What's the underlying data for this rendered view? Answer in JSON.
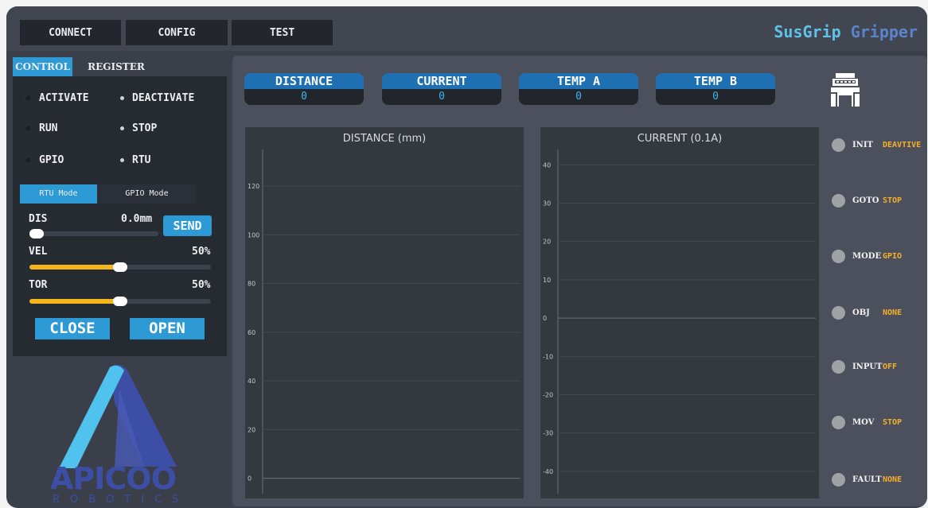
{
  "toolbar": {
    "connect": "CONNECT",
    "config": "CONFIG",
    "test": "TEST"
  },
  "brand": {
    "part1": "SusGrip",
    "part2": "Gripper"
  },
  "tabs": {
    "control": "CONTROL",
    "register": "REGISTER"
  },
  "control": {
    "activate": "ACTIVATE",
    "deactivate": "DEACTIVATE",
    "run": "RUN",
    "stop": "STOP",
    "gpio": "GPIO",
    "rtu": "RTU",
    "rtu_mode": "RTU Mode",
    "gpio_mode": "GPIO Mode",
    "dis_label": "DIS",
    "dis_value": "0.0mm",
    "send": "SEND",
    "vel_label": "VEL",
    "vel_value": "50%",
    "tor_label": "TOR",
    "tor_value": "50%",
    "close": "CLOSE",
    "open": "OPEN",
    "dis_level": 0,
    "vel_level": 0.5,
    "tor_level": 0.5
  },
  "logo": {
    "name": "APICOO",
    "sub": "ROBOTICS"
  },
  "meters": [
    {
      "label": "DISTANCE",
      "value": "0"
    },
    {
      "label": "CURRENT",
      "value": "0"
    },
    {
      "label": "TEMP A",
      "value": "0"
    },
    {
      "label": "TEMP B",
      "value": "0"
    }
  ],
  "charts": {
    "distance": {
      "title": "DISTANCE (mm)",
      "ticks": [
        "120",
        "100",
        "80",
        "60",
        "40",
        "20",
        "0"
      ]
    },
    "current": {
      "title": "CURRENT (0.1A)",
      "ticks": [
        "40",
        "30",
        "20",
        "10",
        "0",
        "-10",
        "-20",
        "-30",
        "-40"
      ]
    }
  },
  "chart_data": [
    {
      "type": "line",
      "title": "DISTANCE (mm)",
      "xlabel": "",
      "ylabel": "",
      "ylim": [
        -5,
        135
      ],
      "yticks": [
        0,
        20,
        40,
        60,
        80,
        100,
        120
      ],
      "series": [],
      "grid": true
    },
    {
      "type": "line",
      "title": "CURRENT (0.1A)",
      "xlabel": "",
      "ylabel": "",
      "ylim": [
        -45,
        44
      ],
      "yticks": [
        -40,
        -30,
        -20,
        -10,
        0,
        10,
        20,
        30,
        40
      ],
      "series": [],
      "grid": true
    }
  ],
  "status": [
    {
      "name": "INIT",
      "value": "DEAVTIVE"
    },
    {
      "name": "GOTO",
      "value": "STOP"
    },
    {
      "name": "MODE",
      "value": "GPIO"
    },
    {
      "name": "OBJ",
      "value": "NONE"
    },
    {
      "name": "INPUT",
      "value": "OFF"
    },
    {
      "name": "MOV",
      "value": "STOP"
    },
    {
      "name": "FAULT",
      "value": "NONE"
    }
  ],
  "colors": {
    "accent": "#2d9ad6",
    "meter_header": "#1f6fb3",
    "slider_fill": "#f5b51d",
    "status_value": "#f4b02a",
    "brand_cyan": "#5ec2e9",
    "brand_blue": "#5b84cd",
    "logo_cyan": "#4fc3ee",
    "logo_indigo": "#3d4ea6"
  },
  "icons": {
    "gripper": "gripper-icon"
  }
}
